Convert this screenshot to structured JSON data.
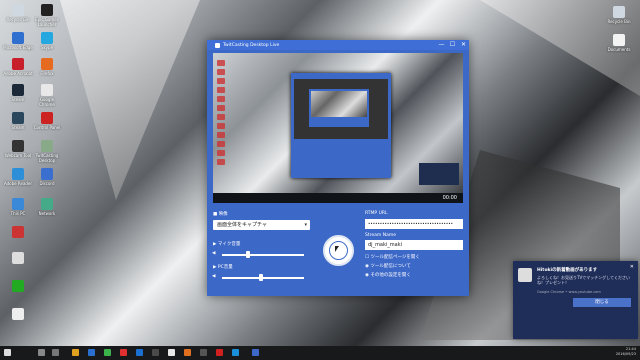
{
  "window": {
    "title": "TwitCasting Desktop Live",
    "minimize_glyph": "—",
    "maximize_glyph": "☐",
    "close_glyph": "✕"
  },
  "preview": {
    "time_label": "00:00"
  },
  "controls": {
    "video_label": "映像",
    "capture_select_value": "画面全体をキャプチャ",
    "mic_label": "マイク音量",
    "pc_audio_label": "PC音量",
    "rtmp_label": "RTMP URL",
    "rtmp_value": "••••••••••••••••••••••••••••••••••••",
    "stream_name_label": "Stream Name",
    "stream_name_value": "dj_maki_maki",
    "option1": "ツール配信ページを開く",
    "option2": "ツール配信について",
    "option3": "その他の設定を開く",
    "mic_level": 0.32,
    "pc_level": 0.48
  },
  "desktop_icons_left": [
    "Recycle Bin",
    "Epic Games Launcher",
    "Microsoft Edge",
    "Skype",
    "Adobe Acrobat",
    "Firefox",
    "Steam",
    "Google Chrome",
    "Steam",
    "Control Panel",
    "Webcam Tool",
    "TwitCasting Desktop",
    "Adobe Reader",
    "Discord",
    "This PC",
    "Network"
  ],
  "desktop_icons_right": [
    "Recycle Bin",
    "Documents"
  ],
  "toast": {
    "title": "Hitokiの新着動画があります",
    "body": "よろしくね！お見送りTVでマッチングしてくださいね！プレゼント！",
    "source": "Google Chrome • www.youtube.com",
    "button_label": "閉じる",
    "close_glyph": "✕"
  },
  "tray": {
    "time": "21:44",
    "date": "2016/09/23"
  },
  "colors": {
    "accent": "#3c68c8",
    "titlebar": "#3f6fd6",
    "toast_bg": "#1f2e58",
    "taskbar": "#18191b"
  }
}
